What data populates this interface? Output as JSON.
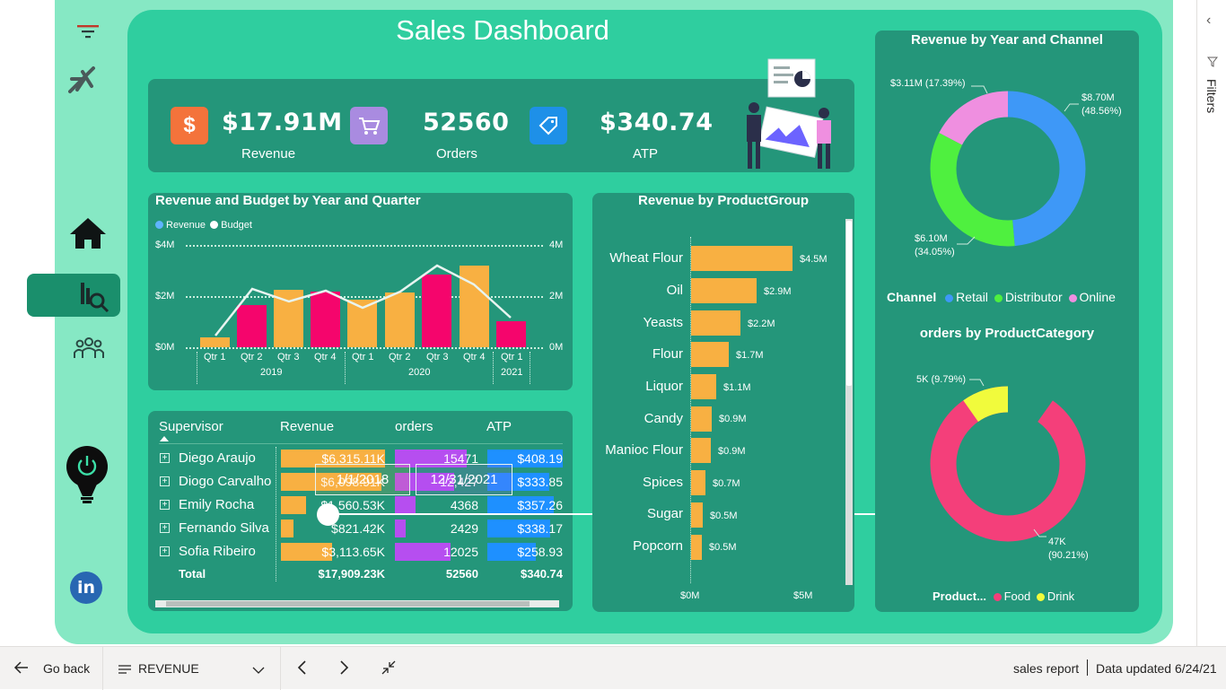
{
  "title": "Sales Dashboard",
  "kpis": [
    {
      "value": "$17.91M",
      "label": "Revenue",
      "icon": "dollar-icon",
      "color": "#f4733b"
    },
    {
      "value": "52560",
      "label": "Orders",
      "icon": "cart-icon",
      "color": "#a98be0"
    },
    {
      "value": "$340.74",
      "label": "ATP",
      "icon": "price-tag-icon",
      "color": "#1e90e8"
    }
  ],
  "revenue_budget_chart": {
    "title": "Revenue and Budget by Year and Quarter",
    "legend": [
      "Revenue",
      "Budget"
    ],
    "left_ticks": [
      "$4M",
      "$2M",
      "$0M"
    ],
    "right_ticks": [
      "4M",
      "2M",
      "0M"
    ],
    "quarters": [
      "Qtr 1",
      "Qtr 2",
      "Qtr 3",
      "Qtr 4",
      "Qtr 1",
      "Qtr 2",
      "Qtr 3",
      "Qtr 4",
      "Qtr 1"
    ],
    "years": [
      "2019",
      "2020",
      "2021"
    ]
  },
  "product_group_chart": {
    "title": "Revenue by ProductGroup",
    "axis_ticks": [
      "$0M",
      "$5M"
    ],
    "rows": [
      {
        "label": "Wheat Flour",
        "value_label": "$4.5M"
      },
      {
        "label": "Oil",
        "value_label": "$2.9M"
      },
      {
        "label": "Yeasts",
        "value_label": "$2.2M"
      },
      {
        "label": "Flour",
        "value_label": "$1.7M"
      },
      {
        "label": "Liquor",
        "value_label": "$1.1M"
      },
      {
        "label": "Candy",
        "value_label": "$0.9M"
      },
      {
        "label": "Manioc Flour",
        "value_label": "$0.9M"
      },
      {
        "label": "Spices",
        "value_label": "$0.7M"
      },
      {
        "label": "Sugar",
        "value_label": "$0.5M"
      },
      {
        "label": "Popcorn",
        "value_label": "$0.5M"
      }
    ]
  },
  "table": {
    "headers": [
      "Supervisor",
      "Revenue",
      "orders",
      "ATP"
    ],
    "rows": [
      {
        "name": "Diego Araujo",
        "revenue": "$6,315.11K",
        "orders": "15471",
        "atp": "$408.19"
      },
      {
        "name": "Diogo Carvalho",
        "revenue": "$6,098.91K",
        "orders": "12,427",
        "atp": "$333.85"
      },
      {
        "name": "Emily Rocha",
        "revenue": "$1,560.53K",
        "orders": "4368",
        "atp": "$357.26"
      },
      {
        "name": "Fernando Silva",
        "revenue": "$821.42K",
        "orders": "2429",
        "atp": "$338.17"
      },
      {
        "name": "Sofia Ribeiro",
        "revenue": "$3,113.65K",
        "orders": "12025",
        "atp": "$258.93"
      }
    ],
    "total": {
      "label": "Total",
      "revenue": "$17,909.23K",
      "orders": "52560",
      "atp": "$340.74"
    },
    "overlay_boxes": [
      "1/1/2018",
      "12/31/2021"
    ]
  },
  "channel_chart": {
    "title": "Revenue by Year and Channel",
    "labels": [
      "$8.70M (48.56%)",
      "$6.10M (34.05%)",
      "$3.11M (17.39%)"
    ],
    "legend_title": "Channel",
    "legend": [
      "Retail",
      "Distributor",
      "Online"
    ]
  },
  "category_chart": {
    "title": "orders by ProductCategory",
    "labels": [
      "47K (90.21%)",
      "5K (9.79%)"
    ],
    "legend_title": "Product...",
    "legend": [
      "Food",
      "Drink"
    ]
  },
  "colors": {
    "revenue_bar_a": "#f8b042",
    "revenue_bar_b": "#f5056c",
    "retail": "#3e98f7",
    "distributor": "#4ff03f",
    "online": "#ef8fe0",
    "food": "#f43f7a",
    "drink": "#f1fb3c"
  },
  "bottom_bar": {
    "go_back": "Go back",
    "page": "REVENUE",
    "report": "sales report",
    "updated": "Data updated 6/24/21"
  },
  "right_pane": {
    "filters": "Filters"
  }
}
